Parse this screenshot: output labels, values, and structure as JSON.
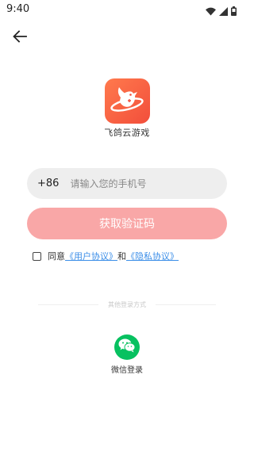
{
  "status_bar": {
    "time": "9:40",
    "icons": [
      "wifi-icon",
      "signal-icon",
      "battery-icon"
    ]
  },
  "header": {
    "back_icon": "arrow-left-icon"
  },
  "app": {
    "name": "飞鸽云游戏",
    "logo_color": "#f4593f"
  },
  "login_form": {
    "country_code": "+86",
    "phone_placeholder": "请输入您的手机号",
    "phone_value": "",
    "get_code_label": "获取验证码",
    "get_code_color": "#f9a7a7"
  },
  "agreement": {
    "prefix": "同意",
    "user_agreement": "《用户协议》",
    "conjunction": "和",
    "privacy_agreement": "《隐私协议》",
    "link_color": "#3b8ee8",
    "checked": false
  },
  "other_login": {
    "divider_text": "其他登录方式",
    "wechat_label": "微信登录",
    "wechat_icon": "wechat-icon",
    "wechat_color": "#07c160"
  }
}
